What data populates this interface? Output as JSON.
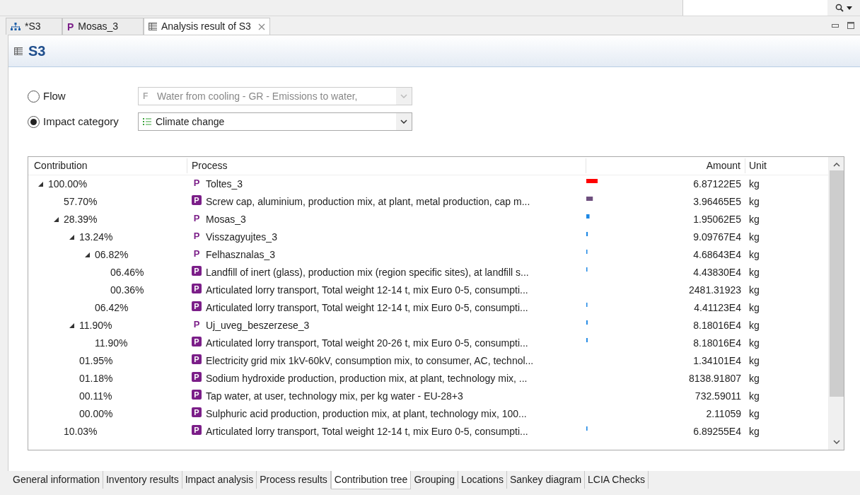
{
  "editor_tabs": [
    {
      "label": "*S3",
      "kind": "system",
      "selected": false,
      "closable": false
    },
    {
      "label": "Mosas_3",
      "kind": "process",
      "icon": "P",
      "selected": false,
      "closable": false
    },
    {
      "label": "Analysis result of S3",
      "kind": "result",
      "selected": true,
      "closable": true
    }
  ],
  "header": {
    "title": "S3"
  },
  "selector": {
    "options": [
      {
        "label": "Flow",
        "selected": false,
        "icon": "F",
        "value": "Water from cooling - GR - Emissions to water,",
        "disabled": true,
        "kind": "flow"
      },
      {
        "label": "Impact category",
        "selected": true,
        "value": "Climate change",
        "disabled": false,
        "kind": "impact"
      }
    ]
  },
  "tree": {
    "columns": [
      "Contribution",
      "Process",
      "Amount",
      "Unit"
    ],
    "rows": [
      {
        "contribution": "100.00%",
        "icon": "P",
        "process": "Toltes_3",
        "kind": "system",
        "level": 1.0,
        "color": "#ff0000",
        "amount": "6.87122E5",
        "unit": "kg",
        "expanded": true,
        "children": [
          {
            "contribution": "57.70%",
            "icon": "P",
            "process": "Screw cap, aluminium, production mix, at plant, metal production, cap m...",
            "kind": "process",
            "level": 0.577,
            "color": "#6e4f7e",
            "amount": "3.96465E5",
            "unit": "kg"
          },
          {
            "contribution": "28.39%",
            "icon": "P",
            "process": "Mosas_3",
            "kind": "system",
            "level": 0.2839,
            "color": "#1e88e5",
            "amount": "1.95062E5",
            "unit": "kg",
            "expanded": true,
            "children": [
              {
                "contribution": "13.24%",
                "icon": "P",
                "process": "Visszagyujtes_3",
                "kind": "system",
                "level": 0.1324,
                "color": "#1e88e5",
                "amount": "9.09767E4",
                "unit": "kg",
                "expanded": true,
                "children": [
                  {
                    "contribution": "06.82%",
                    "icon": "P",
                    "process": "Felhasznalas_3",
                    "kind": "system",
                    "level": 0.0682,
                    "color": "#1e88e5",
                    "amount": "4.68643E4",
                    "unit": "kg",
                    "expanded": true,
                    "children": [
                      {
                        "contribution": "06.46%",
                        "icon": "P",
                        "process": "Landfill of inert (glass), production mix (region specific sites), at landfill s...",
                        "kind": "process",
                        "level": 0.0646,
                        "color": "#1e88e5",
                        "amount": "4.43830E4",
                        "unit": "kg"
                      },
                      {
                        "contribution": "00.36%",
                        "icon": "P",
                        "process": "Articulated lorry transport, Total weight 12-14 t, mix Euro 0-5, consumpti...",
                        "kind": "process",
                        "amount": "2481.31923",
                        "unit": "kg"
                      }
                    ]
                  },
                  {
                    "contribution": "06.42%",
                    "icon": "P",
                    "process": "Articulated lorry transport, Total weight 12-14 t, mix Euro 0-5, consumpti...",
                    "kind": "process",
                    "level": 0.0642,
                    "color": "#1e88e5",
                    "amount": "4.41123E4",
                    "unit": "kg"
                  }
                ]
              },
              {
                "contribution": "11.90%",
                "icon": "P",
                "process": "Uj_uveg_beszerzese_3",
                "kind": "system",
                "level": 0.119,
                "color": "#1e88e5",
                "amount": "8.18016E4",
                "unit": "kg",
                "expanded": true,
                "children": [
                  {
                    "contribution": "11.90%",
                    "icon": "P",
                    "process": "Articulated lorry transport, Total weight 20-26 t, mix Euro 0-5, consumpti...",
                    "kind": "process",
                    "level": 0.119,
                    "color": "#1e88e5",
                    "amount": "8.18016E4",
                    "unit": "kg"
                  }
                ]
              },
              {
                "contribution": "01.95%",
                "icon": "P",
                "process": "Electricity grid mix 1kV-60kV, consumption mix, to consumer, AC, technol...",
                "kind": "process",
                "amount": "1.34101E4",
                "unit": "kg"
              },
              {
                "contribution": "01.18%",
                "icon": "P",
                "process": "Sodium hydroxide production, production mix, at plant, technology mix, ...",
                "kind": "process",
                "amount": "8138.91807",
                "unit": "kg"
              },
              {
                "contribution": "00.11%",
                "icon": "P",
                "process": "Tap water, at user, technology mix, per kg water - EU-28+3",
                "kind": "process",
                "amount": "732.59011",
                "unit": "kg"
              },
              {
                "contribution": "00.00%",
                "icon": "P",
                "process": "Sulphuric acid production, production mix, at plant, technology mix, 100...",
                "kind": "process",
                "amount": "2.11059",
                "unit": "kg"
              }
            ]
          },
          {
            "contribution": "10.03%",
            "icon": "P",
            "process": "Articulated lorry transport, Total weight 12-14 t, mix Euro 0-5, consumpti...",
            "kind": "process",
            "level": 0.1003,
            "color": "#1e88e5",
            "amount": "6.89255E4",
            "unit": "kg"
          }
        ]
      }
    ]
  },
  "bottom_tabs": [
    {
      "label": "General information",
      "selected": false
    },
    {
      "label": "Inventory results",
      "selected": false
    },
    {
      "label": "Impact analysis",
      "selected": false
    },
    {
      "label": "Process results",
      "selected": false
    },
    {
      "label": "Contribution tree",
      "selected": true
    },
    {
      "label": "Grouping",
      "selected": false
    },
    {
      "label": "Locations",
      "selected": false
    },
    {
      "label": "Sankey diagram",
      "selected": false
    },
    {
      "label": "LCIA Checks",
      "selected": false
    }
  ]
}
